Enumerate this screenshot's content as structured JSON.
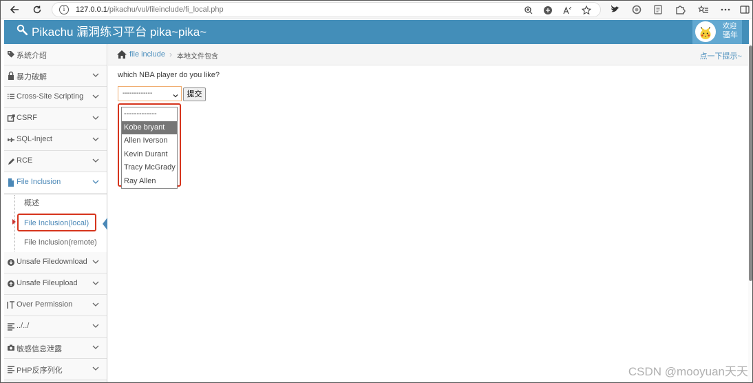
{
  "browser": {
    "url_host": "127.0.0.1",
    "url_path": "/pikachu/vul/fileinclude/fi_local.php",
    "back_icon": "arrow-left",
    "reload_icon": "reload",
    "info_glyph": "i"
  },
  "header": {
    "title": "Pikachu 漏洞练习平台 pika~pika~",
    "welcome": "欢迎",
    "username": "骚年",
    "brand_color": "#438eb9"
  },
  "sidebar": {
    "items": [
      {
        "label": "系统介绍",
        "icon": "tag-icon"
      },
      {
        "label": "暴力破解",
        "icon": "lock-icon"
      },
      {
        "label": "Cross-Site Scripting",
        "icon": "list-icon"
      },
      {
        "label": "CSRF",
        "icon": "share-icon"
      },
      {
        "label": "SQL-Inject",
        "icon": "plane-icon"
      },
      {
        "label": "RCE",
        "icon": "pencil-icon"
      },
      {
        "label": "File Inclusion",
        "icon": "file-icon"
      },
      {
        "label": "Unsafe Filedownload",
        "icon": "download-icon"
      },
      {
        "label": "Unsafe Fileupload",
        "icon": "upload-icon"
      },
      {
        "label": "Over Permission",
        "icon": "text-icon"
      },
      {
        "label": "../../",
        "icon": "list-icon"
      },
      {
        "label": "敏感信息泄露",
        "icon": "camera-icon"
      },
      {
        "label": "PHP反序列化",
        "icon": "list-icon"
      }
    ],
    "sub_items": [
      {
        "label": "概述"
      },
      {
        "label": "File Inclusion(local)"
      },
      {
        "label": "File Inclusion(remote)"
      }
    ]
  },
  "breadcrumb": {
    "link": "file include",
    "separator": "›",
    "current": "本地文件包含",
    "hint": "点一下提示~"
  },
  "main": {
    "question": "which NBA player do you like?",
    "select_value": "-------------",
    "submit_label": "提交",
    "options": [
      "-------------",
      "Kobe bryant",
      "Allen Iverson",
      "Kevin Durant",
      "Tracy McGrady",
      "Ray Allen"
    ],
    "highlighted_option": "Kobe bryant"
  },
  "watermark": "CSDN @mooyuan天天"
}
